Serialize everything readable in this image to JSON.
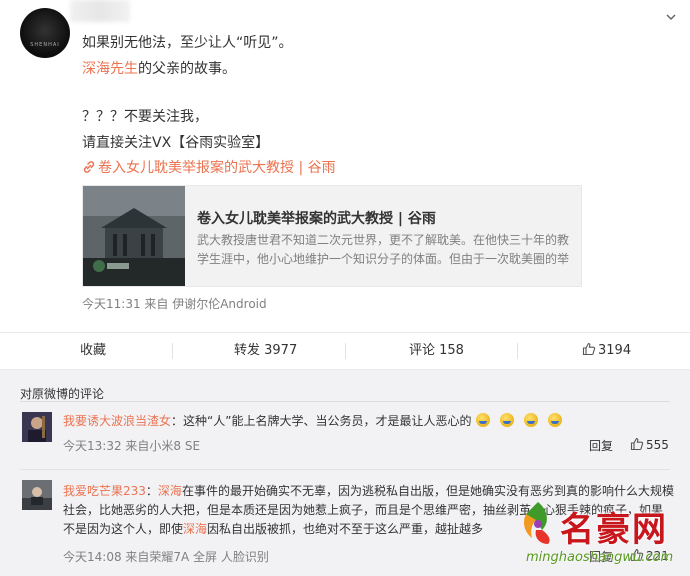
{
  "post": {
    "avatar_mark": "SHENHAI",
    "line1": "如果别无他法，至少让人“听见”。",
    "line2_hl": "深海先生",
    "line2_rest": "的父亲的故事。",
    "line3": "？？？不要关注我，",
    "line4": "请直接关注VX【谷雨实验室】",
    "link_text": "卷入女儿耽美举报案的武大教授 | 谷雨",
    "card": {
      "title": "卷入女儿耽美举报案的武大教授 | 谷雨",
      "desc": "武大教授唐世君不知道二次元世界，更不了解耽美。在他快三十年的教学生涯中，他小心地维护一个知识分子的体面。但由于一次耽美圈的举"
    },
    "meta": "今天11:31 来自 伊谢尔伦Android"
  },
  "actions": {
    "collect": "收藏",
    "repost": "转发 3977",
    "comment": "评论 158",
    "like": "3194"
  },
  "comments": {
    "title": "对原微博的评论",
    "items": [
      {
        "user": "我要诱大波浪当渣女",
        "text": "：这种“人”能上名牌大学、当公务员，才是最让人恶心的",
        "meta": "今天13:32 来自小米8 SE",
        "reply": "回复",
        "likes": "555"
      },
      {
        "user": "我爱吃芒果233",
        "colon": "：",
        "hl1": "深海",
        "text1": "在事件的最开始确实不无辜，因为逃税私自出版，但是她确实没有恶劣到真的影响什么大规模",
        "text2": "社会，比她恶劣的人大把，但是本质还是因为她惹上疯子，而且是个思维严密，抽丝剥茧，心狠手辣的疯子，如果",
        "text3a": "不是因为这个人，即使",
        "hl2": "深海",
        "text3b": "因私自出版被抓，也绝对不至于这么严重，越扯越多",
        "meta": "今天14:08 来自荣耀7A 全屏 人脸识别",
        "reply": "回复",
        "likes": "221"
      }
    ]
  },
  "watermark": {
    "title": "名豪网",
    "url": "minghaoshangwu.com"
  },
  "colors": {
    "accent": "#eb7350",
    "meta": "#808080",
    "comments_bg": "#f2f2f5"
  },
  "icons": [
    "chevron-down-icon",
    "link-icon",
    "thumbs-up-icon"
  ]
}
